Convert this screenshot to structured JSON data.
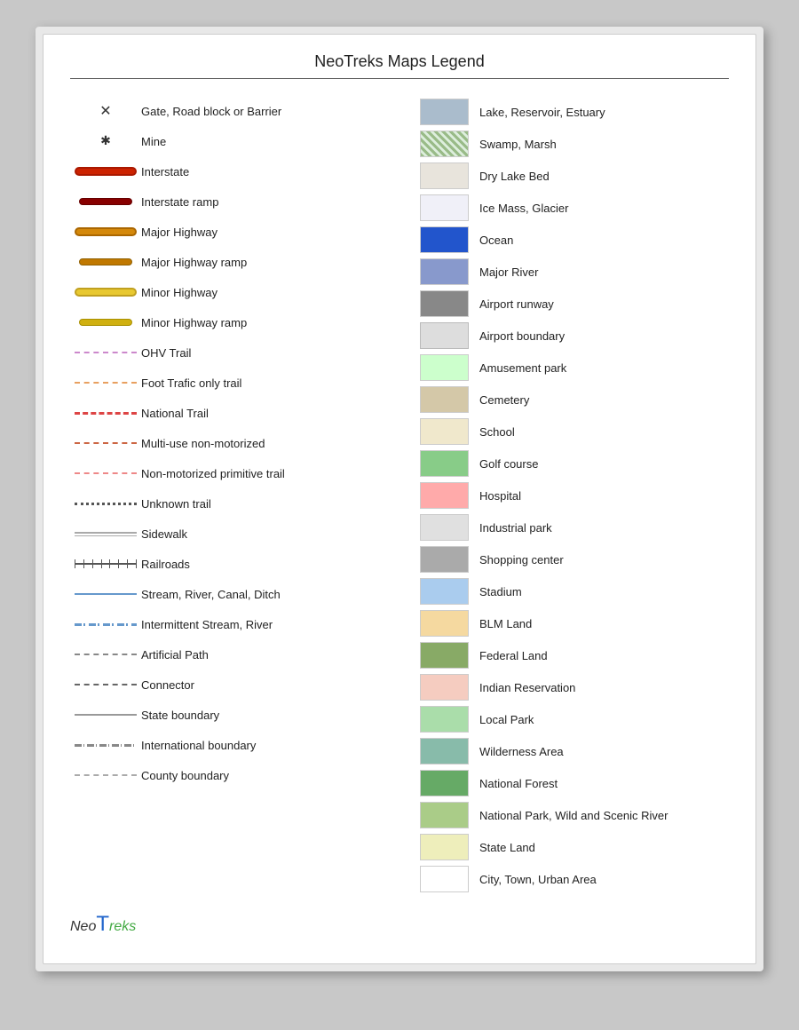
{
  "title": "NeoTreks Maps Legend",
  "left_items": [
    {
      "id": "gate",
      "symbol_type": "x",
      "label": "Gate, Road block or Barrier"
    },
    {
      "id": "mine",
      "symbol_type": "asterisk",
      "label": "Mine"
    },
    {
      "id": "interstate",
      "symbol_type": "interstate",
      "label": "Interstate"
    },
    {
      "id": "interstate-ramp",
      "symbol_type": "interstate-ramp",
      "label": "Interstate ramp"
    },
    {
      "id": "major-hwy",
      "symbol_type": "major-hwy",
      "label": "Major Highway"
    },
    {
      "id": "major-hwy-ramp",
      "symbol_type": "major-hwy-ramp",
      "label": "Major Highway ramp"
    },
    {
      "id": "minor-hwy",
      "symbol_type": "minor-hwy",
      "label": "Minor Highway"
    },
    {
      "id": "minor-hwy-ramp",
      "symbol_type": "minor-hwy-ramp",
      "label": "Minor Highway ramp"
    },
    {
      "id": "ohv-trail",
      "symbol_type": "ohv-trail",
      "label": "OHV Trail"
    },
    {
      "id": "foot-trail",
      "symbol_type": "foot-trail",
      "label": "Foot Trafic only trail"
    },
    {
      "id": "national-trail",
      "symbol_type": "national-trail",
      "label": "National Trail"
    },
    {
      "id": "multi-use",
      "symbol_type": "multi-use",
      "label": "Multi-use non-motorized"
    },
    {
      "id": "non-motorized",
      "symbol_type": "non-motorized",
      "label": "Non-motorized primitive trail"
    },
    {
      "id": "unknown-trail",
      "symbol_type": "unknown-trail",
      "label": "Unknown trail"
    },
    {
      "id": "sidewalk",
      "symbol_type": "sidewalk",
      "label": "Sidewalk"
    },
    {
      "id": "railroad",
      "symbol_type": "railroad",
      "label": "Railroads"
    },
    {
      "id": "stream",
      "symbol_type": "stream",
      "label": "Stream, River, Canal, Ditch"
    },
    {
      "id": "intermittent",
      "symbol_type": "intermittent",
      "label": "Intermittent Stream, River"
    },
    {
      "id": "artificial",
      "symbol_type": "artificial",
      "label": "Artificial Path"
    },
    {
      "id": "connector",
      "symbol_type": "connector",
      "label": "Connector"
    },
    {
      "id": "state-boundary",
      "symbol_type": "state-boundary",
      "label": "State boundary"
    },
    {
      "id": "intl-boundary",
      "symbol_type": "intl-boundary",
      "label": "International boundary"
    },
    {
      "id": "county-boundary",
      "symbol_type": "county-boundary",
      "label": "County boundary"
    }
  ],
  "right_items": [
    {
      "id": "lake",
      "swatch": "swatch-lake",
      "label": "Lake, Reservoir, Estuary"
    },
    {
      "id": "swamp",
      "swatch": "swatch-swamp",
      "label": "Swamp, Marsh"
    },
    {
      "id": "drylake",
      "swatch": "swatch-drylake",
      "label": "Dry Lake Bed"
    },
    {
      "id": "ice",
      "swatch": "swatch-ice",
      "label": "Ice Mass, Glacier"
    },
    {
      "id": "ocean",
      "swatch": "swatch-ocean",
      "label": "Ocean"
    },
    {
      "id": "major-river",
      "swatch": "swatch-major-river",
      "label": "Major River"
    },
    {
      "id": "airport-runway",
      "swatch": "swatch-airport-runway",
      "label": "Airport runway"
    },
    {
      "id": "airport-boundary",
      "swatch": "swatch-airport-boundary",
      "label": "Airport boundary"
    },
    {
      "id": "amusement",
      "swatch": "swatch-amusement",
      "label": "Amusement park"
    },
    {
      "id": "cemetery",
      "swatch": "swatch-cemetery",
      "label": "Cemetery"
    },
    {
      "id": "school",
      "swatch": "swatch-school",
      "label": "School"
    },
    {
      "id": "golf",
      "swatch": "swatch-golf",
      "label": "Golf course"
    },
    {
      "id": "hospital",
      "swatch": "swatch-hospital",
      "label": "Hospital"
    },
    {
      "id": "industrial",
      "swatch": "swatch-industrial",
      "label": "Industrial park"
    },
    {
      "id": "shopping",
      "swatch": "swatch-shopping",
      "label": "Shopping center"
    },
    {
      "id": "stadium",
      "swatch": "swatch-stadium",
      "label": "Stadium"
    },
    {
      "id": "blm",
      "swatch": "swatch-blm",
      "label": "BLM Land"
    },
    {
      "id": "federal",
      "swatch": "swatch-federal",
      "label": "Federal Land"
    },
    {
      "id": "indian",
      "swatch": "swatch-indian",
      "label": "Indian Reservation"
    },
    {
      "id": "local-park",
      "swatch": "swatch-local-park",
      "label": "Local Park"
    },
    {
      "id": "wilderness",
      "swatch": "swatch-wilderness",
      "label": "Wilderness Area"
    },
    {
      "id": "national-forest",
      "swatch": "swatch-national-forest",
      "label": "National Forest"
    },
    {
      "id": "national-park",
      "swatch": "swatch-national-park",
      "label": "National Park, Wild and Scenic River"
    },
    {
      "id": "state-land",
      "swatch": "swatch-state-land",
      "label": "State Land"
    },
    {
      "id": "city",
      "swatch": "swatch-city",
      "label": "City, Town, Urban Area"
    }
  ],
  "logo": {
    "neo": "Neo",
    "t": "T",
    "reks": "reks"
  }
}
